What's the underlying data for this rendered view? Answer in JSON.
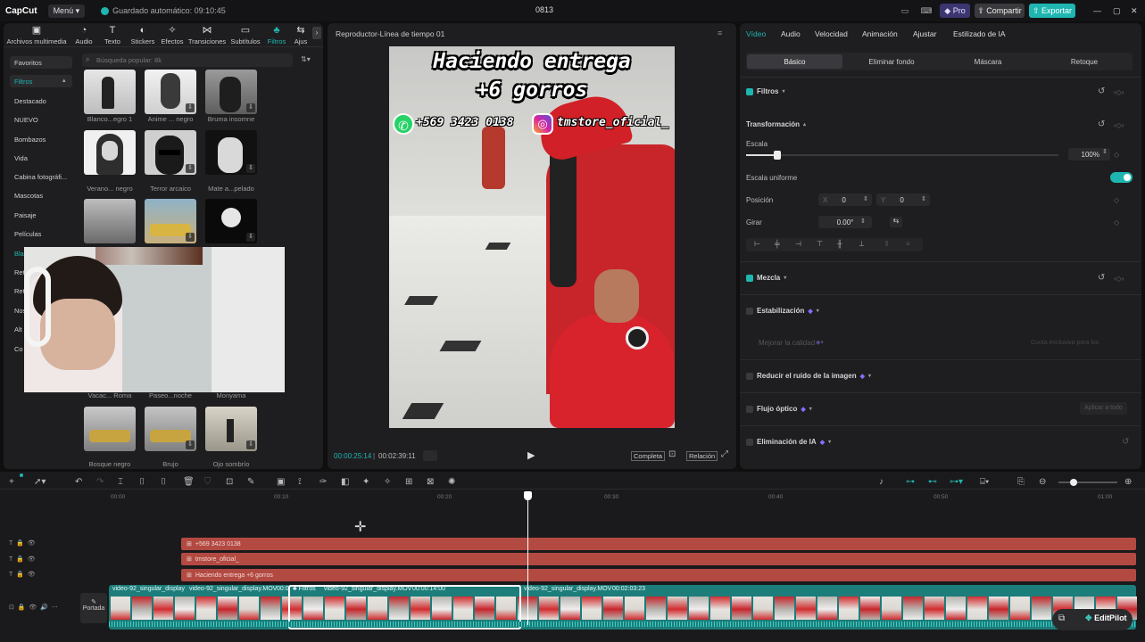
{
  "titlebar": {
    "app_name": "CapCut",
    "menu_label": "Menú",
    "saved_status": "Guardado automático: 09:10:45",
    "project_title": "0813",
    "pro_label": "Pro",
    "share_label": "Compartir",
    "export_label": "Exportar"
  },
  "toolbar": {
    "items": [
      "Archivos multimedia",
      "Audio",
      "Texto",
      "Stickers",
      "Efectos",
      "Transiciones",
      "Subtítulos",
      "Filtros",
      "Ajus"
    ]
  },
  "filters": {
    "search_placeholder": "Búsqueda popular: 8k",
    "categories": [
      "Favoritos",
      "Filtros",
      "Destacado",
      "NUEVO",
      "Bombazos",
      "Vida",
      "Cabina fotográfi...",
      "Mascotas",
      "Paisaje",
      "Películas",
      "Bla",
      "Retr",
      "Retr",
      "Nos",
      "Alt",
      "Co"
    ],
    "thumbs_row1": [
      "Blanco...egro 1",
      "Anime ... negro",
      "Bruma insomne"
    ],
    "thumbs_row2": [
      "Verano... negro",
      "Terror arcaico",
      "Mate a...pelado"
    ],
    "thumbs_row4": [
      "Vacac... Roma",
      "Paseo...noche",
      "Monyama"
    ],
    "thumbs_row5": [
      "Bosque negro",
      "Brujo",
      "Ojo sombrío"
    ]
  },
  "player": {
    "header": "Reproductor-Línea de tiempo 01",
    "overlay_line1": "Haciendo entrega",
    "overlay_line2": "+6 gorros",
    "whatsapp_text": "+569 3423 0138",
    "instagram_text": "tmstore_oficial_",
    "current_time": "00:00:25:14",
    "total_time": "00:02:39:11",
    "btn_complete": "Completa",
    "btn_ratio": "Relación"
  },
  "inspector": {
    "tabs": [
      "Vídeo",
      "Audio",
      "Velocidad",
      "Animación",
      "Ajustar",
      "Estilizado de IA"
    ],
    "subtabs": [
      "Básico",
      "Eliminar fondo",
      "Máscara",
      "Retoque"
    ],
    "filtros_label": "Filtros",
    "transform_label": "Transformación",
    "scale_label": "Escala",
    "scale_value": "100%",
    "scale_fraction": 0.1,
    "uniform_label": "Escala uniforme",
    "position_label": "Posición",
    "pos_x_label": "X",
    "pos_x": "0",
    "pos_y_label": "Y",
    "pos_y": "0",
    "rotate_label": "Girar",
    "rotate_value": "0.00°",
    "blend_label": "Mezcla",
    "stabilize_label": "Estabilización",
    "enhance_label": "Mejorar la calidad",
    "enhance_hint": "Cuota exclusiva para los",
    "denoise_label": "Reducir el ruido de la imagen",
    "optical_flow_label": "Flujo óptico",
    "apply_all_label": "Aplicar a todo",
    "ai_remove_label": "Eliminación de IA",
    "accent_color": "#1fb6b1"
  },
  "timeline": {
    "ruler": [
      "00:00",
      "00:10",
      "00:20",
      "00:30",
      "00:40",
      "00:50",
      "01:00"
    ],
    "text_tracks": [
      "+569 3423 0138",
      "tmstore_oficial_",
      "Haciendo entrega +6 gorros"
    ],
    "cover_label": "Portada",
    "clip1_name": "video-92_singular_display",
    "clip2_name": "video-92_singular_display.MOV",
    "clip2_dur": "00:0",
    "clip3_filter": "Filtros",
    "clip3_name": "video-92_singular_display.MOV",
    "clip3_dur": "00:00:14:00",
    "clip4_name": "video-92_singular_display.MOV",
    "clip4_dur": "00:02:03:23",
    "editpilot_label": "EditPilot",
    "track_color": "#b24a42",
    "video_track_color": "#1c7d7a"
  }
}
